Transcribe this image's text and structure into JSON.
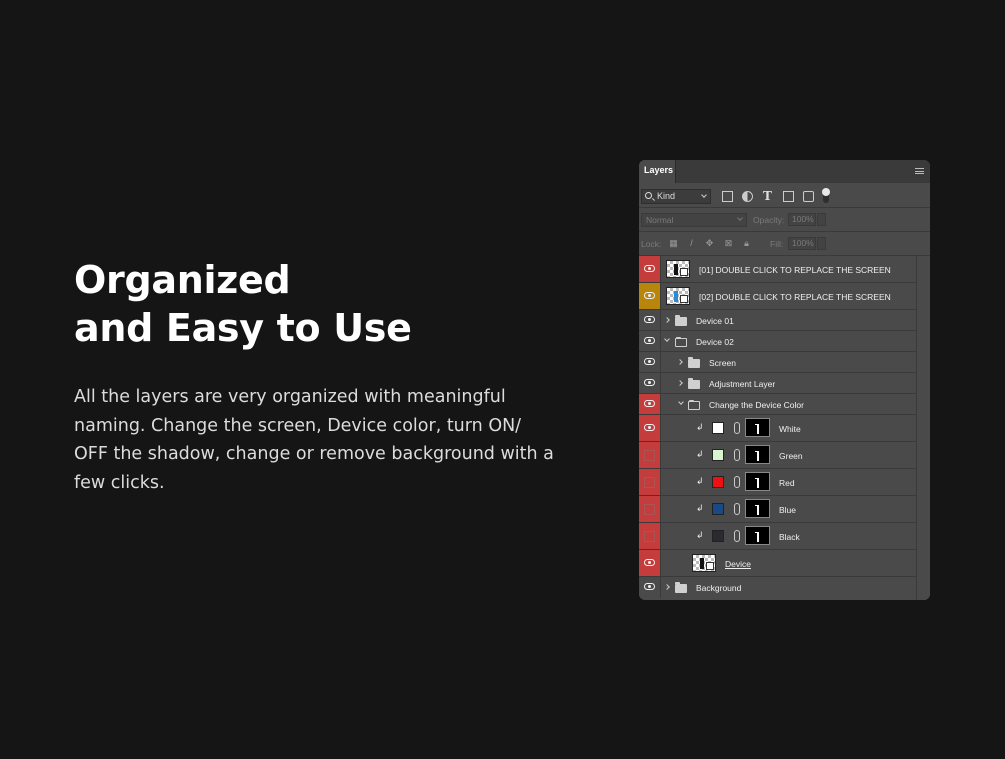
{
  "hero": {
    "title_line1": "Organized",
    "title_line2": "and Easy to Use",
    "body": "All the layers are very organized with meaningful naming. Change the screen, Device color, turn ON/ OFF the shadow, change or remove background with a few clicks."
  },
  "panel": {
    "tab_label": "Layers",
    "filter": {
      "kind_label": "Kind"
    },
    "blend": {
      "mode": "Normal",
      "opacity_label": "Opacity:",
      "opacity_value": "100%"
    },
    "lock": {
      "lock_label": "Lock:",
      "fill_label": "Fill:",
      "fill_value": "100%"
    },
    "layers": [
      {
        "name": "[01] DOUBLE CLICK TO REPLACE THE SCREEN"
      },
      {
        "name": "[02] DOUBLE CLICK TO REPLACE THE SCREEN"
      },
      {
        "name": "Device 01"
      },
      {
        "name": "Device 02"
      },
      {
        "name": "Screen"
      },
      {
        "name": "Adjustment Layer"
      },
      {
        "name": "Change the Device Color"
      },
      {
        "name": "White",
        "color": "#ffffff"
      },
      {
        "name": "Green",
        "color": "#d8f5d0"
      },
      {
        "name": "Red",
        "color": "#ee1111"
      },
      {
        "name": "Blue",
        "color": "#1a4a85"
      },
      {
        "name": "Black",
        "color": "#2a2a30"
      },
      {
        "name": "Device"
      },
      {
        "name": "Background"
      }
    ]
  },
  "colors": {
    "background": "#151515",
    "panel": "#4a4a4a",
    "visible_red": "#c43c3c",
    "visible_gold": "#b8860b"
  }
}
